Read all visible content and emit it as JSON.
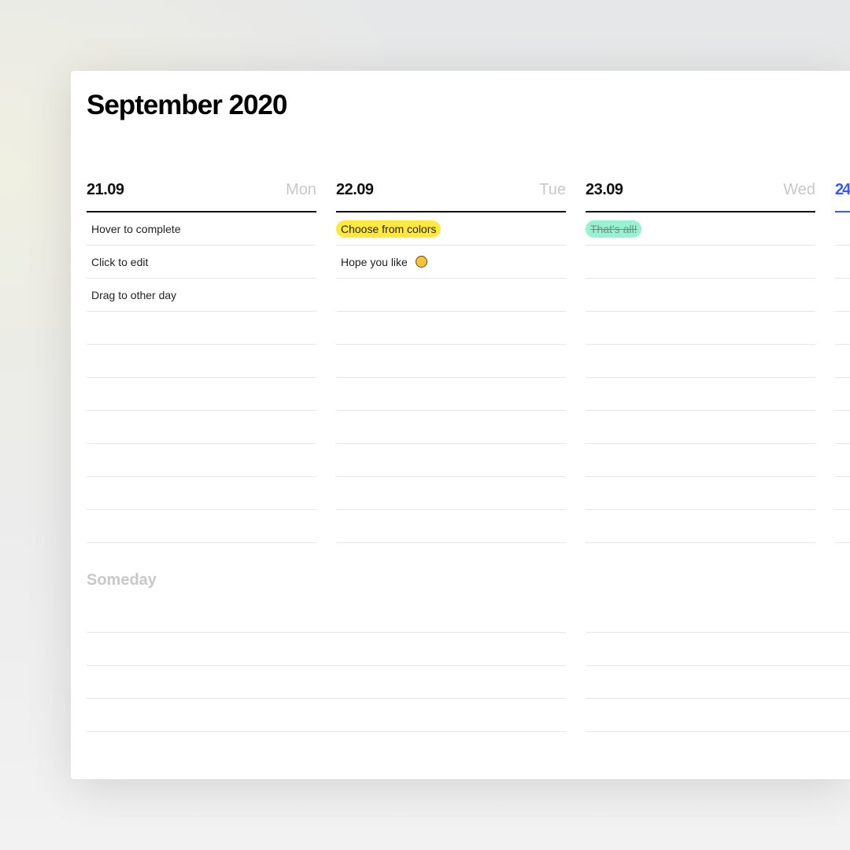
{
  "title": "September 2020",
  "days": [
    {
      "date": "21.09",
      "weekday": "Mon",
      "tasks": [
        {
          "text": "Hover to complete",
          "highlight": null,
          "done": false
        },
        {
          "text": "Click to edit",
          "highlight": null,
          "done": false
        },
        {
          "text": "Drag to other day",
          "highlight": null,
          "done": false
        }
      ]
    },
    {
      "date": "22.09",
      "weekday": "Tue",
      "tasks": [
        {
          "text": "Choose from colors",
          "highlight": "#ffe93f",
          "done": false
        },
        {
          "text": "Hope you like",
          "highlight": null,
          "done": false,
          "icon": "winking-face-emoji-icon"
        }
      ]
    },
    {
      "date": "23.09",
      "weekday": "Wed",
      "tasks": [
        {
          "text": "That's all!",
          "highlight": "#96f2cf",
          "done": true
        }
      ]
    },
    {
      "date": "24",
      "weekday": "",
      "today": true,
      "tasks": []
    }
  ],
  "someday": {
    "title": "Someday"
  },
  "colors": {
    "today_accent": "#3d5afe",
    "yellow": "#ffe93f",
    "mint": "#96f2cf"
  }
}
